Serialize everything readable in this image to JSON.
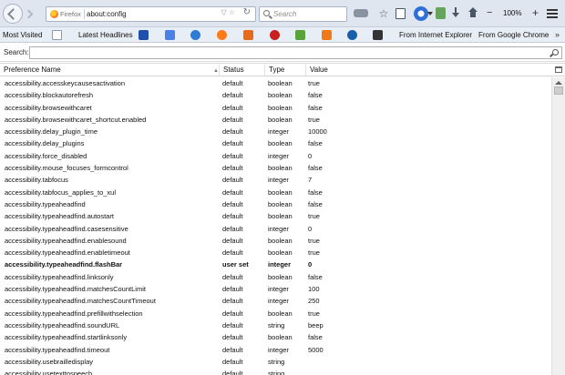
{
  "navbar": {
    "identity_label": "Firefox",
    "url": "about:config",
    "search_placeholder": "Search",
    "zoom_minus": "−",
    "zoom_level": "100%",
    "zoom_plus": "+"
  },
  "bookmarks": {
    "most_visited": "Most Visited",
    "latest_headlines": "Latest Headlines",
    "from_ie": "From Internet Explorer",
    "from_chrome": "From Google Chrome",
    "overflow": "»",
    "icon_colors": [
      "#1f4fa8",
      "#4a80e8",
      "#2d7bd6",
      "#ff7a1a",
      "#e86a1a",
      "#c82020",
      "#5aa33a",
      "#f07a1a",
      "#1a5faa",
      "#333333"
    ]
  },
  "config": {
    "search_label": "Search:",
    "search_value": ""
  },
  "table": {
    "headers": {
      "name": "Preference Name",
      "status": "Status",
      "type": "Type",
      "value": "Value"
    },
    "rows": [
      {
        "name": "accessibility.accesskeycausesactivation",
        "status": "default",
        "type": "boolean",
        "value": "true"
      },
      {
        "name": "accessibility.blockautorefresh",
        "status": "default",
        "type": "boolean",
        "value": "false"
      },
      {
        "name": "accessibility.browsewithcaret",
        "status": "default",
        "type": "boolean",
        "value": "false"
      },
      {
        "name": "accessibility.browsewithcaret_shortcut.enabled",
        "status": "default",
        "type": "boolean",
        "value": "true"
      },
      {
        "name": "accessibility.delay_plugin_time",
        "status": "default",
        "type": "integer",
        "value": "10000"
      },
      {
        "name": "accessibility.delay_plugins",
        "status": "default",
        "type": "boolean",
        "value": "false"
      },
      {
        "name": "accessibility.force_disabled",
        "status": "default",
        "type": "integer",
        "value": "0"
      },
      {
        "name": "accessibility.mouse_focuses_formcontrol",
        "status": "default",
        "type": "boolean",
        "value": "false"
      },
      {
        "name": "accessibility.tabfocus",
        "status": "default",
        "type": "integer",
        "value": "7"
      },
      {
        "name": "accessibility.tabfocus_applies_to_xul",
        "status": "default",
        "type": "boolean",
        "value": "false"
      },
      {
        "name": "accessibility.typeaheadfind",
        "status": "default",
        "type": "boolean",
        "value": "false"
      },
      {
        "name": "accessibility.typeaheadfind.autostart",
        "status": "default",
        "type": "boolean",
        "value": "true"
      },
      {
        "name": "accessibility.typeaheadfind.casesensitive",
        "status": "default",
        "type": "integer",
        "value": "0"
      },
      {
        "name": "accessibility.typeaheadfind.enablesound",
        "status": "default",
        "type": "boolean",
        "value": "true"
      },
      {
        "name": "accessibility.typeaheadfind.enabletimeout",
        "status": "default",
        "type": "boolean",
        "value": "true"
      },
      {
        "name": "accessibility.typeaheadfind.flashBar",
        "status": "user set",
        "type": "integer",
        "value": "0",
        "modified": true
      },
      {
        "name": "accessibility.typeaheadfind.linksonly",
        "status": "default",
        "type": "boolean",
        "value": "false"
      },
      {
        "name": "accessibility.typeaheadfind.matchesCountLimit",
        "status": "default",
        "type": "integer",
        "value": "100"
      },
      {
        "name": "accessibility.typeaheadfind.matchesCountTimeout",
        "status": "default",
        "type": "integer",
        "value": "250"
      },
      {
        "name": "accessibility.typeaheadfind.prefillwithselection",
        "status": "default",
        "type": "boolean",
        "value": "true"
      },
      {
        "name": "accessibility.typeaheadfind.soundURL",
        "status": "default",
        "type": "string",
        "value": "beep"
      },
      {
        "name": "accessibility.typeaheadfind.startlinksonly",
        "status": "default",
        "type": "boolean",
        "value": "false"
      },
      {
        "name": "accessibility.typeaheadfind.timeout",
        "status": "default",
        "type": "integer",
        "value": "5000"
      },
      {
        "name": "accessibility.usebrailledisplay",
        "status": "default",
        "type": "string",
        "value": ""
      },
      {
        "name": "accessibility.usetexttospeech",
        "status": "default",
        "type": "string",
        "value": ""
      }
    ]
  }
}
